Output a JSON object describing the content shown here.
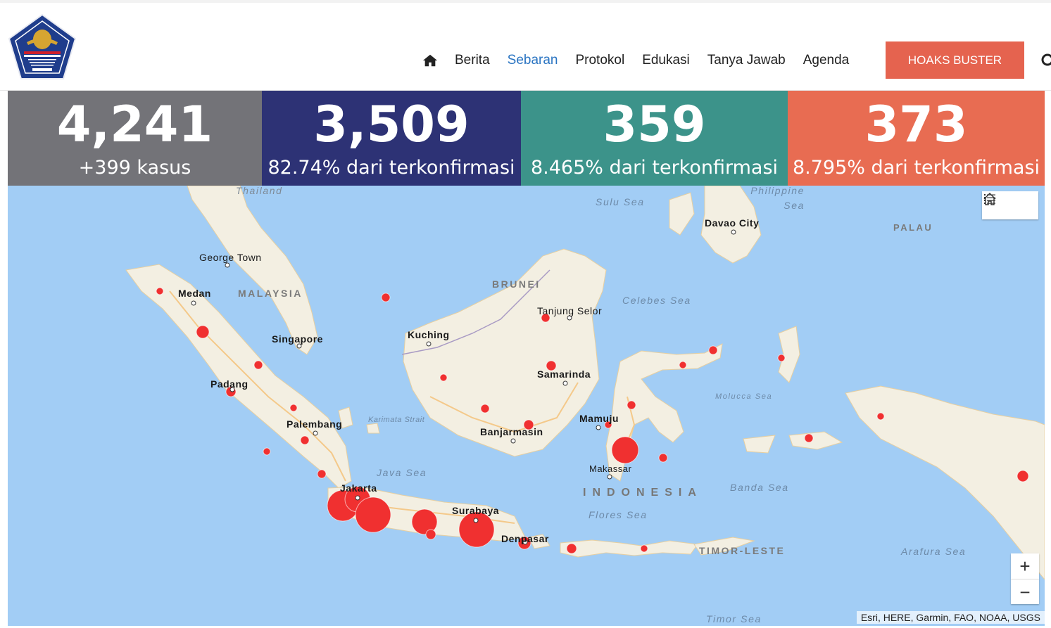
{
  "header": {
    "nav": {
      "home_icon": "home-icon",
      "items": [
        "Berita",
        "Sebaran",
        "Protokol",
        "Edukasi",
        "Tanya Jawab",
        "Agenda"
      ],
      "active": "Sebaran",
      "active_color": "#2a74c2"
    },
    "hoaks_button": "HOAKS BUSTER",
    "hoaks_color": "#e5634f"
  },
  "stats": [
    {
      "value": "4,241",
      "caption": "+399 kasus",
      "color": "#737378"
    },
    {
      "value": "3,509",
      "caption": "82.74% dari terkonfirmasi",
      "color": "#2d3275"
    },
    {
      "value": "359",
      "caption": "8.465% dari terkonfirmasi",
      "color": "#3c938a"
    },
    {
      "value": "373",
      "caption": "8.795% dari terkonfirmasi",
      "color": "#e86c52"
    }
  ],
  "map": {
    "cities": [
      "George Town",
      "Medan",
      "Singapore",
      "Padang",
      "Palembang",
      "Jakarta",
      "Surabaya",
      "Denpasar",
      "Kuching",
      "Tanjung Selor",
      "Samarinda",
      "Banjarmasin",
      "Mamuju",
      "Makassar",
      "Davao City"
    ],
    "countries": [
      "Thailand",
      "MALAYSIA",
      "BRUNEI",
      "PALAU",
      "TIMOR-LESTE"
    ],
    "country_main": "INDONESIA",
    "seas": [
      "Sulu Sea",
      "Philippine Sea",
      "Celebes Sea",
      "Molucca Sea",
      "Karimata Strait",
      "Java Sea",
      "Flores Sea",
      "Banda Sea",
      "Arafura Sea",
      "Timor Sea"
    ],
    "attribution": "Esri, HERE, Garmin, FAO, NOAA, USGS",
    "zoom_in": "+",
    "zoom_out": "−",
    "marker_color": "#f03030"
  }
}
